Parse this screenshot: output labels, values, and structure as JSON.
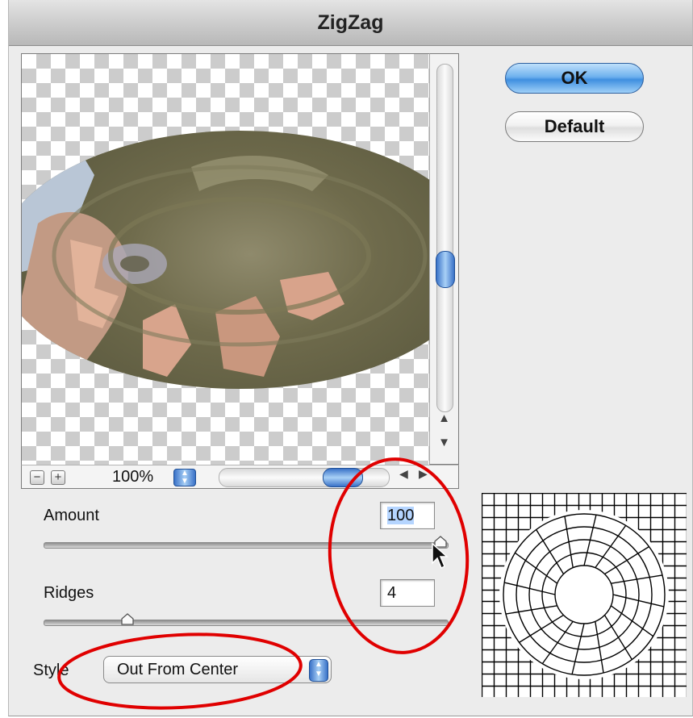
{
  "window": {
    "title": "ZigZag"
  },
  "buttons": {
    "ok": "OK",
    "default": "Default"
  },
  "zoom": {
    "value": "100%",
    "minus": "−",
    "plus": "+"
  },
  "controls": {
    "amount": {
      "label": "Amount",
      "value": "100"
    },
    "ridges": {
      "label": "Ridges",
      "value": "4"
    },
    "style": {
      "label": "Style",
      "value": "Out From Center"
    }
  },
  "slider_levels": {
    "amount": 1.0,
    "ridges": 0.2
  },
  "icons": [
    "zoom-out-icon",
    "zoom-in-icon",
    "scroll-up-arrow-icon",
    "scroll-down-arrow-icon",
    "scroll-left-arrow-icon",
    "scroll-right-arrow-icon",
    "mouse-cursor-icon"
  ],
  "colors": {
    "annotation": "#e00000",
    "accent": "#3f8fe0"
  }
}
